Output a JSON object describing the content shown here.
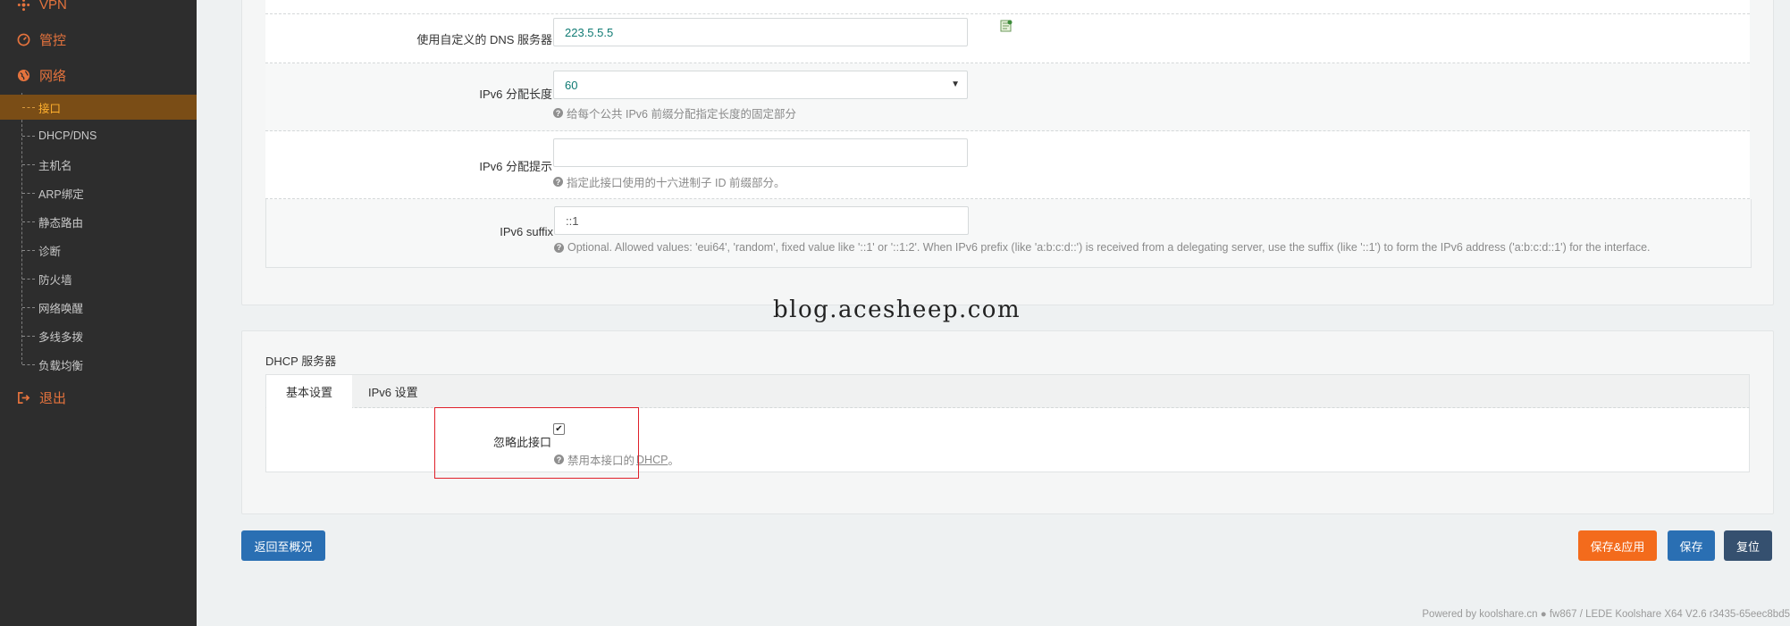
{
  "sidebar": {
    "vpn": "VPN",
    "manage": "管控",
    "network": "网络",
    "logout": "退出",
    "sub_items": [
      "接口",
      "DHCP/DNS",
      "主机名",
      "ARP绑定",
      "静态路由",
      "诊断",
      "防火墙",
      "网络唤醒",
      "多线多拨",
      "负载均衡"
    ]
  },
  "form": {
    "dns_label": "使用自定义的 DNS 服务器",
    "dns_value": "223.5.5.5",
    "ipv6_len_label": "IPv6 分配长度",
    "ipv6_len_value": "60",
    "ipv6_len_help": "给每个公共 IPv6 前缀分配指定长度的固定部分",
    "ipv6_hint_label": "IPv6 分配提示",
    "ipv6_hint_value": "",
    "ipv6_hint_help": "指定此接口使用的十六进制子 ID 前缀部分。",
    "ipv6_suffix_label": "IPv6 suffix",
    "ipv6_suffix_value": "::1",
    "ipv6_suffix_help": "Optional. Allowed values: 'eui64', 'random', fixed value like '::1' or '::1:2'. When IPv6 prefix (like 'a:b:c:d::') is received from a delegating server, use the suffix (like '::1') to form the IPv6 address ('a:b:c:d::1') for the interface."
  },
  "watermark": "blog.acesheep.com",
  "dhcp": {
    "section_title": "DHCP 服务器",
    "tabs": [
      "基本设置",
      "IPv6 设置"
    ],
    "ignore_label": "忽略此接口",
    "ignore_checked": true,
    "ignore_help_prefix": "禁用本接口的",
    "ignore_help_link": "DHCP",
    "ignore_help_suffix": "。"
  },
  "buttons": {
    "back": "返回至概况",
    "save_apply": "保存&应用",
    "save": "保存",
    "reset": "复位"
  },
  "footer": "Powered by koolshare.cn ● fw867 / LEDE Koolshare X64 V2.6 r3435-65eec8bd5",
  "colors": {
    "sidebar_bg": "#2d2d2d",
    "accent_orange": "#e5733d",
    "active_bg": "#7a4d16",
    "active_text": "#ffb02e",
    "btn_blue": "#2a6fb3",
    "btn_orange": "#f36b1c",
    "btn_dark": "#35506f"
  }
}
